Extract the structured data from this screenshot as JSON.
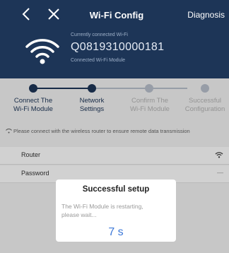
{
  "header": {
    "title": "Wi-Fi Config",
    "diagnosis_label": "Diagnosis",
    "current_label": "Currently connected Wi-Fi",
    "current_wifi": "Q0819310000181",
    "current_status": "Connected Wi-Fi Module"
  },
  "steps": [
    {
      "label_line1": "Connect The",
      "label_line2": "Wi-Fi Module",
      "state": "done"
    },
    {
      "label_line1": "Network",
      "label_line2": "Settings",
      "state": "current"
    },
    {
      "label_line1": "Confirm The",
      "label_line2": "Wi-Fi Module",
      "state": "pending"
    },
    {
      "label_line1": "Successful",
      "label_line2": "Configuration",
      "state": "pending"
    }
  ],
  "notice": {
    "text": "Please connect with the wireless router to ensure remote data transmission"
  },
  "form": {
    "router_label": "Router",
    "password_label": "Password"
  },
  "dialog": {
    "title": "Successful setup",
    "message_line1": "The Wi-Fi Module is restarting,",
    "message_line2": "please wait...",
    "countdown": "7 s"
  },
  "colors": {
    "header_bg": "#1d3557",
    "active_step": "#1d3557",
    "inactive_step": "#b9c0cc",
    "countdown": "#3d78d8"
  }
}
